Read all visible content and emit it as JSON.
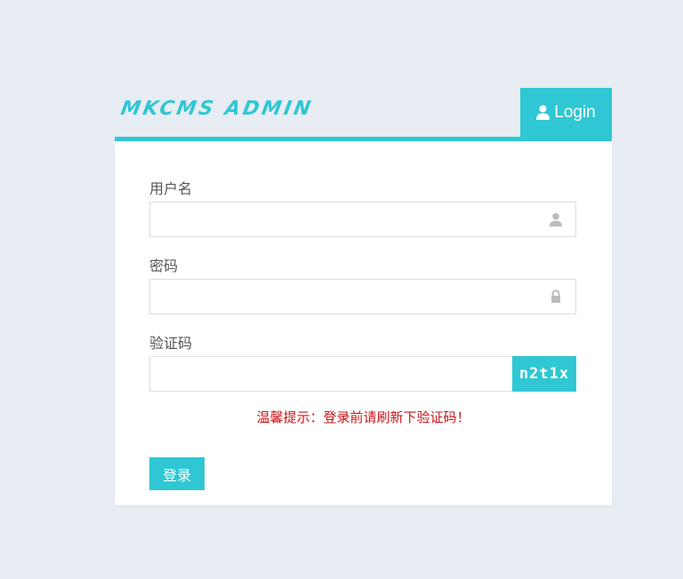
{
  "header": {
    "logo_text": "MKCMS ADMIN",
    "login_tab_label": "Login"
  },
  "form": {
    "username": {
      "label": "用户名",
      "value": "",
      "icon": "user-icon"
    },
    "password": {
      "label": "密码",
      "value": "",
      "icon": "lock-icon"
    },
    "captcha": {
      "label": "验证码",
      "value": "",
      "code": "n2t1x"
    },
    "tip": "温馨提示：登录前请刷新下验证码！",
    "submit_label": "登录"
  },
  "colors": {
    "accent": "#2fc7d3",
    "background": "#e8ecf3",
    "tip": "#c9171b"
  }
}
